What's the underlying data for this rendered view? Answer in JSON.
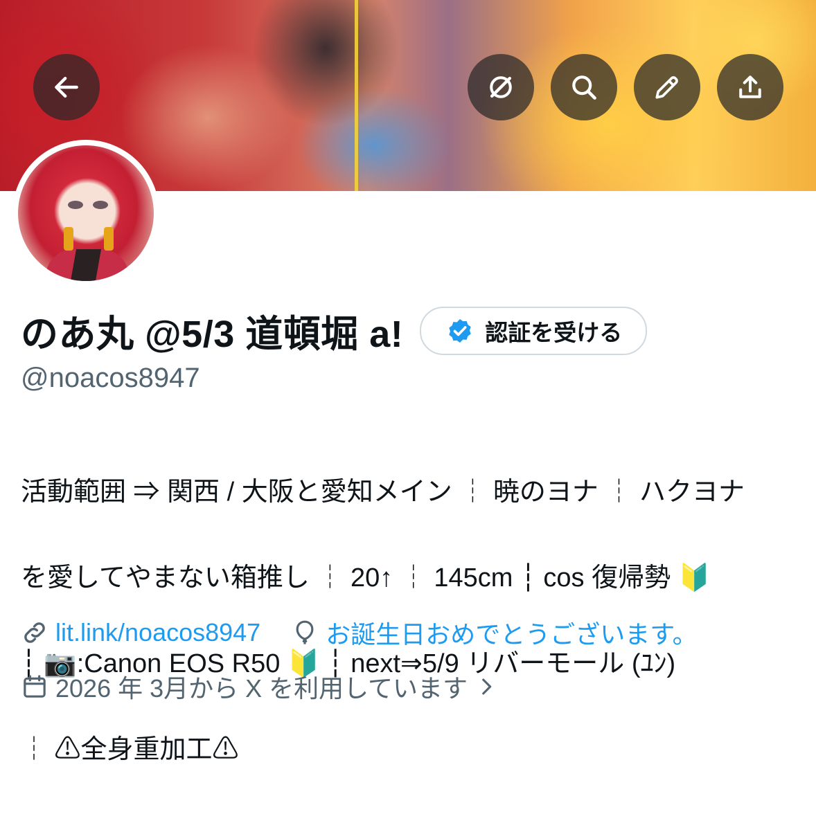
{
  "header": {
    "icons": [
      "back-arrow-icon",
      "grok-icon",
      "search-icon",
      "edit-pencil-icon",
      "share-icon"
    ],
    "string_color": "#f4d23a"
  },
  "profile": {
    "display_name": "のあ丸 @5/3 道頓堀 a!",
    "verify_button_label": "認証を受ける",
    "handle": "@noacos8947",
    "bio_lines": [
      "活動範囲 ⇒ 関西 / 大阪と愛知メイン ┆ 暁のヨナ ┆ ハクヨナ",
      "を愛してやまない箱推し ┆ 20↑ ┆ 145cm ┆ cos 復帰勢 🔰",
      "┆ 📷:Canon EOS R50 🔰 ┆ next⇒5/9 リバーモール (ﾕﾝ)",
      "┆ ⚠全身重加工⚠"
    ],
    "website": "lit.link/noacos8947",
    "birthday_text": "お誕生日おめでとうございます。",
    "joined_text": "2026 年 3月から X を利用しています"
  },
  "colors": {
    "accent": "#1d9bf0",
    "secondary_text": "#536471",
    "primary_text": "#0f1419",
    "border": "#cfd9de"
  }
}
